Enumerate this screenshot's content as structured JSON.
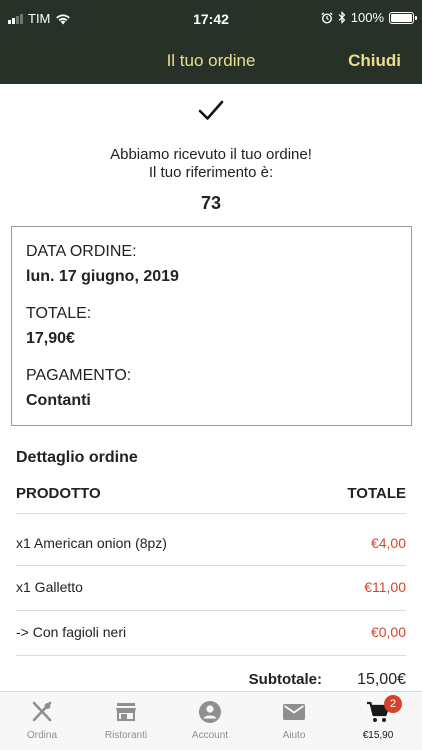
{
  "status_bar": {
    "carrier": "TIM",
    "time": "17:42",
    "battery": "100%"
  },
  "nav": {
    "title": "Il tuo ordine",
    "close_label": "Chiudi"
  },
  "confirmation": {
    "line1": "Abbiamo ricevuto il tuo ordine!",
    "line2": "Il tuo riferimento è:",
    "reference": "73"
  },
  "summary": {
    "date_label": "DATA ORDINE:",
    "date_value": "lun. 17 giugno, 2019",
    "total_label": "TOTALE:",
    "total_value": "17,90€",
    "payment_label": "PAGAMENTO:",
    "payment_value": "Contanti"
  },
  "detail": {
    "title": "Dettaglio ordine",
    "col_product": "PRODOTTO",
    "col_total": "TOTALE",
    "items": [
      {
        "name": "x1 American onion (8pz)",
        "price": "€4,00"
      },
      {
        "name": "x1 Galletto",
        "price": "€11,00"
      },
      {
        "name": "-> Con fagioli neri",
        "price": "€0,00"
      }
    ],
    "subtotal_label": "Subtotale:",
    "subtotal_value": "15,00€"
  },
  "tabbar": {
    "tabs": [
      {
        "label": "Ordina",
        "icon": "cutlery-icon"
      },
      {
        "label": "Ristoranti",
        "icon": "store-icon"
      },
      {
        "label": "Account",
        "icon": "account-icon"
      },
      {
        "label": "Aiuto",
        "icon": "mail-icon"
      },
      {
        "label": "€15,90",
        "icon": "cart-icon",
        "badge": "2"
      }
    ]
  },
  "colors": {
    "header_bg": "#273127",
    "header_text": "#e8df8d",
    "price_accent": "#d4462a",
    "badge": "#d9412e"
  }
}
